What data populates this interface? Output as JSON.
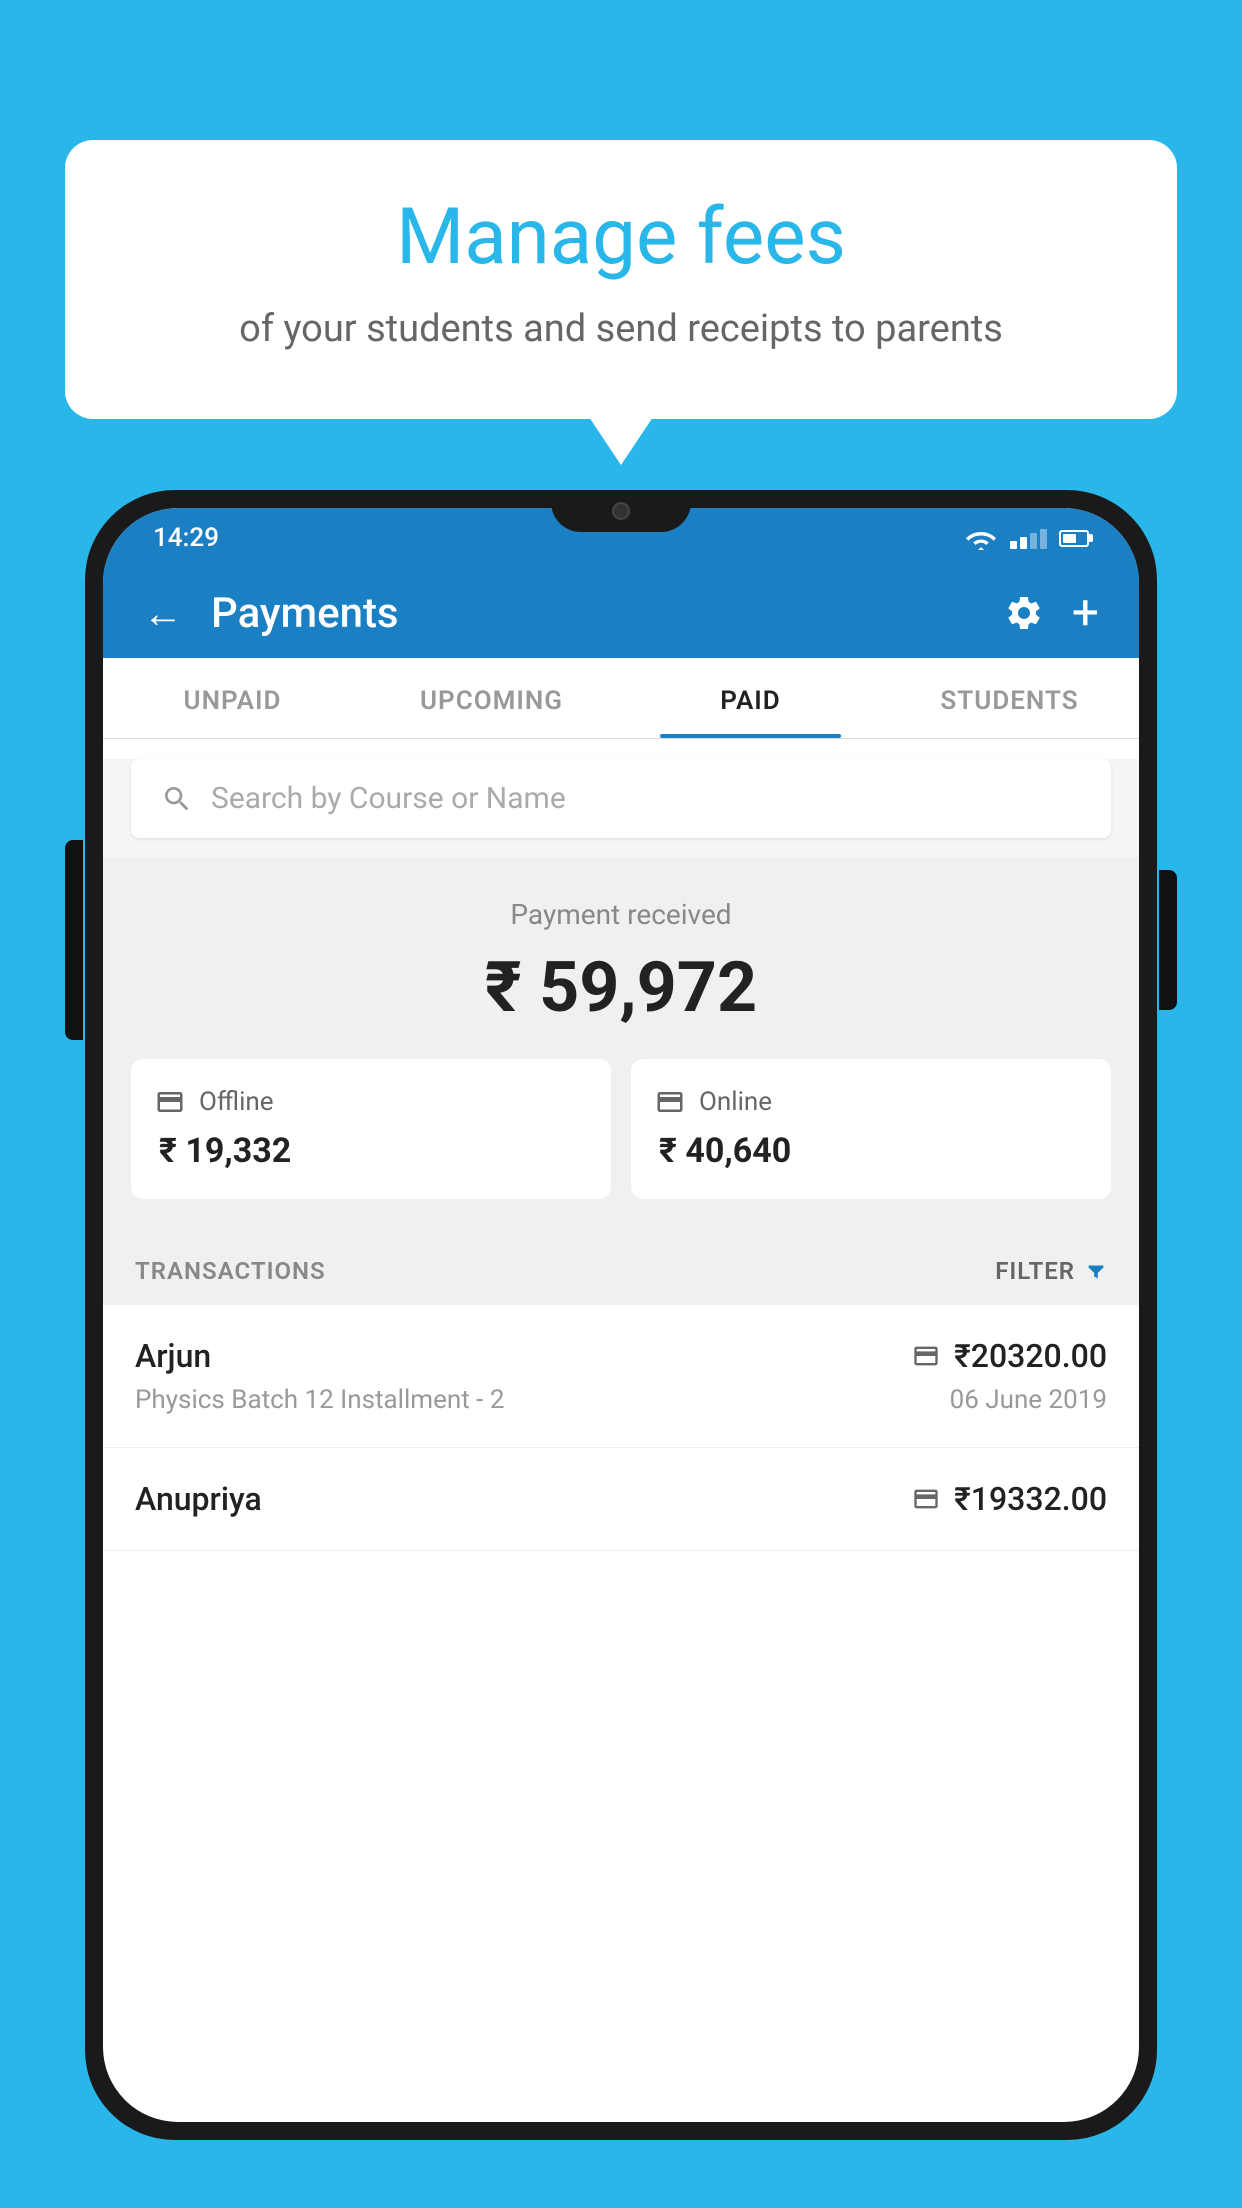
{
  "background_color": "#29b6e8",
  "speech_bubble": {
    "title": "Manage fees",
    "subtitle": "of your students and send receipts to parents"
  },
  "status_bar": {
    "time": "14:29"
  },
  "header": {
    "title": "Payments",
    "back_label": "←",
    "plus_label": "+"
  },
  "tabs": [
    {
      "label": "UNPAID",
      "active": false
    },
    {
      "label": "UPCOMING",
      "active": false
    },
    {
      "label": "PAID",
      "active": true
    },
    {
      "label": "STUDENTS",
      "active": false
    }
  ],
  "search": {
    "placeholder": "Search by Course or Name"
  },
  "payment_section": {
    "label": "Payment received",
    "total_amount": "₹ 59,972",
    "offline": {
      "label": "Offline",
      "amount": "₹ 19,332"
    },
    "online": {
      "label": "Online",
      "amount": "₹ 40,640"
    }
  },
  "transactions": {
    "label": "TRANSACTIONS",
    "filter_label": "FILTER",
    "rows": [
      {
        "name": "Arjun",
        "detail": "Physics Batch 12 Installment - 2",
        "amount": "₹20320.00",
        "date": "06 June 2019",
        "type": "online"
      },
      {
        "name": "Anupriya",
        "detail": "",
        "amount": "₹19332.00",
        "date": "",
        "type": "offline"
      }
    ]
  }
}
